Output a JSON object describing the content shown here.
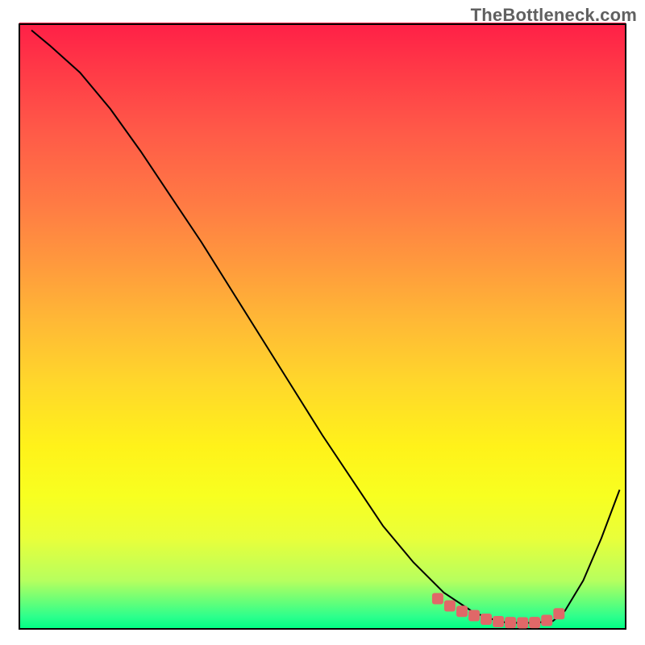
{
  "watermark": "TheBottleneck.com",
  "colors": {
    "curve": "#000000",
    "marker": "#e06868",
    "frame": "#000000"
  },
  "chart_data": {
    "type": "line",
    "title": "",
    "xlabel": "",
    "ylabel": "",
    "xlim": [
      0,
      100
    ],
    "ylim": [
      0,
      100
    ],
    "series": [
      {
        "name": "curve",
        "x": [
          2,
          5,
          10,
          15,
          20,
          25,
          30,
          35,
          40,
          45,
          50,
          55,
          60,
          65,
          70,
          73,
          75,
          78,
          80,
          82,
          85,
          88,
          90,
          93,
          96,
          99
        ],
        "y": [
          99,
          96.5,
          92,
          86,
          79,
          71.5,
          64,
          56,
          48,
          40,
          32,
          24.5,
          17,
          11,
          6,
          4,
          2.7,
          1.6,
          1.1,
          1,
          1,
          1.3,
          3,
          8,
          15,
          23
        ]
      }
    ],
    "markers": {
      "name": "bottom-highlight",
      "x": [
        69,
        71,
        73,
        75,
        77,
        79,
        81,
        83,
        85,
        87,
        89
      ],
      "y": [
        5.0,
        3.8,
        2.9,
        2.2,
        1.6,
        1.2,
        1.05,
        1.0,
        1.05,
        1.4,
        2.5
      ]
    }
  }
}
